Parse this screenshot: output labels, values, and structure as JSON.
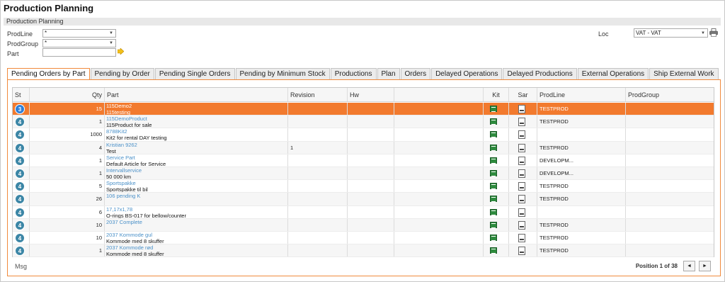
{
  "app": {
    "title": "Production Planning"
  },
  "section": {
    "title": "Production Planning"
  },
  "filters": {
    "prodline": {
      "label": "ProdLine",
      "value": "*"
    },
    "prodgroup": {
      "label": "ProdGroup",
      "value": "*"
    },
    "part": {
      "label": "Part",
      "value": ""
    },
    "loc": {
      "label": "Loc",
      "value": "VAT - VAT"
    }
  },
  "tabs": [
    {
      "label": "Pending Orders by Part",
      "active": true
    },
    {
      "label": "Pending by Order"
    },
    {
      "label": "Pending Single Orders"
    },
    {
      "label": "Pending by Minimum Stock"
    },
    {
      "label": "Productions"
    },
    {
      "label": "Plan"
    },
    {
      "label": "Orders"
    },
    {
      "label": "Delayed Operations"
    },
    {
      "label": "Delayed Productions"
    },
    {
      "label": "External Operations"
    },
    {
      "label": "Ship External Work"
    }
  ],
  "grid": {
    "columns": {
      "st": "St",
      "qty": "Qty",
      "part": "Part",
      "revision": "Revision",
      "hw": "Hw",
      "blank": "",
      "kit": "Kit",
      "sar": "Sar",
      "prodline": "ProdLine",
      "prodgroup": "ProdGroup"
    },
    "rows": [
      {
        "st": "3",
        "qty": "15",
        "part": "115Demo2",
        "desc": "115testing",
        "revision": "",
        "prodline": "TESTPROD",
        "selected": true
      },
      {
        "st": "4",
        "qty": "1",
        "part": "115DemoProduct",
        "desc": "115Product for sale",
        "revision": "",
        "prodline": "TESTPROD"
      },
      {
        "st": "4",
        "qty": "1000",
        "part": "8788Kit2",
        "desc": "Kit2 for rental DAY testing",
        "revision": "",
        "prodline": ""
      },
      {
        "st": "4",
        "qty": "4",
        "part": "Kristian 9262",
        "desc": "Test",
        "revision": "1",
        "prodline": "TESTPROD"
      },
      {
        "st": "4",
        "qty": "1",
        "part": "Service Part",
        "desc": "Default Article for Service",
        "revision": "",
        "prodline": "DEVELOPM..."
      },
      {
        "st": "4",
        "qty": "1",
        "part": "Intervallservice",
        "desc": "50 000 km",
        "revision": "",
        "prodline": "DEVELOPM..."
      },
      {
        "st": "4",
        "qty": "5",
        "part": "Sportspakke",
        "desc": "Sportspakke til bil",
        "revision": "",
        "prodline": "TESTPROD"
      },
      {
        "st": "4",
        "qty": "26",
        "part": "106 pending K",
        "desc": "",
        "revision": "",
        "prodline": "TESTPROD"
      },
      {
        "st": "4",
        "qty": "6",
        "part": "17,17x1,78",
        "desc": "O-rings BS-017 for bellow/counter",
        "revision": "",
        "prodline": ""
      },
      {
        "st": "4",
        "qty": "10",
        "part": "2037 Complete",
        "desc": "",
        "revision": "",
        "prodline": "TESTPROD"
      },
      {
        "st": "4",
        "qty": "10",
        "part": "2037 Kommode gul",
        "desc": "Kommode med 8 skuffer",
        "revision": "",
        "prodline": "TESTPROD"
      },
      {
        "st": "4",
        "qty": "1",
        "part": "2037 Kommode rød",
        "desc": "Kommode med 8 skuffer",
        "revision": "",
        "prodline": "TESTPROD"
      }
    ]
  },
  "status": {
    "msg": "Msg",
    "position_prefix": "Position",
    "position": "1",
    "of_word": "of",
    "total": "38",
    "prev_icon": "prev-icon",
    "next_icon": "next-icon"
  },
  "colors": {
    "accent": "#f27a2e",
    "status_badge": "#3c86a6",
    "link": "#4a90c8"
  }
}
